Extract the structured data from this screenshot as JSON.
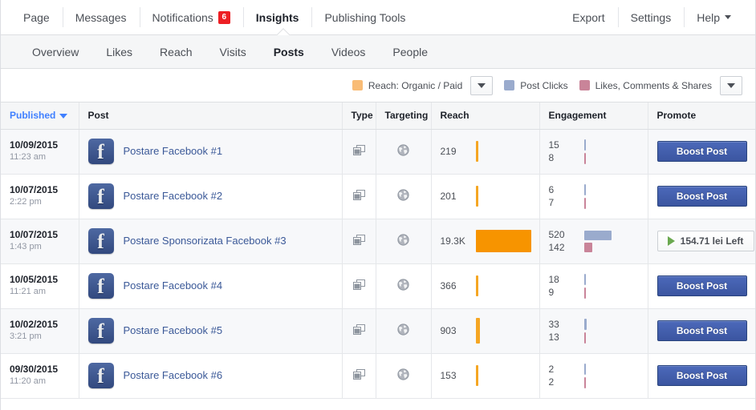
{
  "topnav": {
    "left_items": [
      {
        "label": "Page",
        "badge": null,
        "active": false,
        "caret": false
      },
      {
        "label": "Messages",
        "badge": null,
        "active": false,
        "caret": false
      },
      {
        "label": "Notifications",
        "badge": "6",
        "active": false,
        "caret": false
      },
      {
        "label": "Insights",
        "badge": null,
        "active": true,
        "caret": false
      },
      {
        "label": "Publishing Tools",
        "badge": null,
        "active": false,
        "caret": false
      }
    ],
    "right_items": [
      {
        "label": "Export",
        "badge": null,
        "active": false,
        "caret": false
      },
      {
        "label": "Settings",
        "badge": null,
        "active": false,
        "caret": false
      },
      {
        "label": "Help",
        "badge": null,
        "active": false,
        "caret": true
      }
    ]
  },
  "subnav": {
    "items": [
      {
        "label": "Overview",
        "active": false
      },
      {
        "label": "Likes",
        "active": false
      },
      {
        "label": "Reach",
        "active": false
      },
      {
        "label": "Visits",
        "active": false
      },
      {
        "label": "Posts",
        "active": true
      },
      {
        "label": "Videos",
        "active": false
      },
      {
        "label": "People",
        "active": false
      }
    ]
  },
  "legend": {
    "reach": {
      "label": "Reach: Organic / Paid",
      "color": "#f9bc76"
    },
    "clicks": {
      "label": "Post Clicks",
      "color": "#9aabcd"
    },
    "likes": {
      "label": "Likes, Comments & Shares",
      "color": "#c98499"
    },
    "dropdown_icon": "chevron-down-icon"
  },
  "table": {
    "headers": {
      "published": "Published",
      "post": "Post",
      "type": "Type",
      "targeting": "Targeting",
      "reach": "Reach",
      "engagement": "Engagement",
      "promote": "Promote"
    },
    "sort_column": "published",
    "rows": [
      {
        "date": "10/09/2015",
        "time": "11:23 am",
        "title": "Postare Facebook #1",
        "type_icon": "photo-post-icon",
        "targeting_icon": "globe-icon",
        "reach": "219",
        "reach_organic_w": 3,
        "reach_paid_w": 0,
        "clicks": "15",
        "engagement2": "8",
        "clicks_w": 2,
        "likes_w": 2,
        "promote": {
          "type": "boost",
          "label": "Boost Post"
        }
      },
      {
        "date": "10/07/2015",
        "time": "2:22 pm",
        "title": "Postare Facebook #2",
        "type_icon": "photo-post-icon",
        "targeting_icon": "globe-icon",
        "reach": "201",
        "reach_organic_w": 3,
        "reach_paid_w": 0,
        "clicks": "6",
        "engagement2": "7",
        "clicks_w": 2,
        "likes_w": 2,
        "promote": {
          "type": "boost",
          "label": "Boost Post"
        }
      },
      {
        "date": "10/07/2015",
        "time": "1:43 pm",
        "title": "Postare Sponsorizata Facebook #3",
        "type_icon": "photo-post-icon",
        "targeting_icon": "globe-icon",
        "reach": "19.3K",
        "reach_organic_w": 3,
        "reach_paid_w": 69,
        "clicks": "520",
        "engagement2": "142",
        "clicks_w": 34,
        "likes_w": 10,
        "promote": {
          "type": "budget",
          "label": "154.71 lei Left"
        }
      },
      {
        "date": "10/05/2015",
        "time": "11:21 am",
        "title": "Postare Facebook #4",
        "type_icon": "photo-post-icon",
        "targeting_icon": "globe-icon",
        "reach": "366",
        "reach_organic_w": 3,
        "reach_paid_w": 0,
        "clicks": "18",
        "engagement2": "9",
        "clicks_w": 2,
        "likes_w": 2,
        "promote": {
          "type": "boost",
          "label": "Boost Post"
        }
      },
      {
        "date": "10/02/2015",
        "time": "3:21 pm",
        "title": "Postare Facebook #5",
        "type_icon": "photo-post-icon",
        "targeting_icon": "globe-icon",
        "reach": "903",
        "reach_organic_w": 5,
        "reach_paid_w": 0,
        "clicks": "33",
        "engagement2": "13",
        "clicks_w": 3,
        "likes_w": 2,
        "promote": {
          "type": "boost",
          "label": "Boost Post"
        }
      },
      {
        "date": "09/30/2015",
        "time": "11:20 am",
        "title": "Postare Facebook #6",
        "type_icon": "photo-post-icon",
        "targeting_icon": "globe-icon",
        "reach": "153",
        "reach_organic_w": 3,
        "reach_paid_w": 0,
        "clicks": "2",
        "engagement2": "2",
        "clicks_w": 2,
        "likes_w": 2,
        "promote": {
          "type": "boost",
          "label": "Boost Post"
        }
      }
    ]
  }
}
